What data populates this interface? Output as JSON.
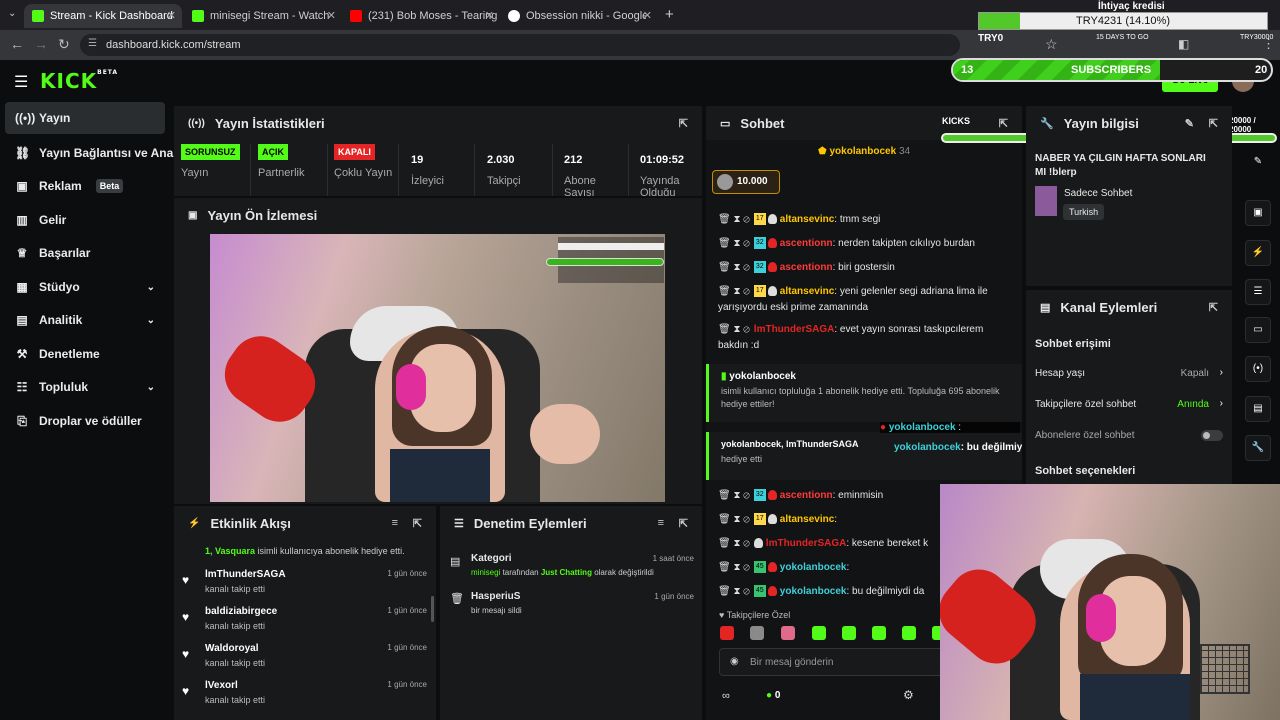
{
  "browser": {
    "tabs": [
      {
        "label": "Stream - Kick Dashboard"
      },
      {
        "label": "minisegi Stream - Watch Live o"
      },
      {
        "label": "(231) Bob Moses - Tearing"
      },
      {
        "label": "Obsession nikki - Google'da Ar"
      }
    ],
    "url": "dashboard.kick.com/stream"
  },
  "overlay": {
    "credit_title": "İhtiyaç kredisi",
    "credit_value": "TRY4231 (14.10%)",
    "try0": "TRY0",
    "days_left": "15 DAYS TO GO",
    "try30000": "TRY30000",
    "sub_count": "13",
    "sub_label": "SUBSCRIBERS",
    "sub_goal": "20",
    "kicks_label": "KICKS",
    "kicks_value": "20000 / 20000"
  },
  "header": {
    "logo": "KICK",
    "logo_beta": "BETA",
    "go_live": "Go Live"
  },
  "sidebar": {
    "items": [
      {
        "label": "Yayın"
      },
      {
        "label": "Yayın Bağlantısı ve Anahtarı"
      },
      {
        "label": "Reklam",
        "badge": "Beta"
      },
      {
        "label": "Gelir"
      },
      {
        "label": "Başarılar"
      },
      {
        "label": "Stüdyo"
      },
      {
        "label": "Analitik"
      },
      {
        "label": "Denetleme"
      },
      {
        "label": "Topluluk"
      },
      {
        "label": "Droplar ve ödüller"
      }
    ]
  },
  "stats": {
    "title": "Yayın İstatistikleri",
    "items": [
      {
        "value": "SORUNSUZ",
        "label": "Yayın"
      },
      {
        "value": "AÇIK",
        "label": "Partnerlik"
      },
      {
        "value": "KAPALI",
        "label": "Çoklu Yayın"
      },
      {
        "value": "19",
        "label": "İzleyici"
      },
      {
        "value": "2.030",
        "label": "Takipçi"
      },
      {
        "value": "212",
        "label": "Abone Sayısı"
      },
      {
        "value": "01:09:52",
        "label": "Yayında Olduğu Süre"
      }
    ]
  },
  "preview": {
    "title": "Yayın Ön İzlemesi"
  },
  "activity": {
    "title": "Etkinlik Akışı",
    "top_note_name": "1, Vasquara",
    "top_note_text": "isimli kullanıcıya abonelik hediye etti.",
    "items": [
      {
        "name": "lmThunderSAGA",
        "sub": "kanalı takip etti",
        "time": "1 gün önce"
      },
      {
        "name": "baldiziabirgece",
        "sub": "kanalı takip etti",
        "time": "1 gün önce"
      },
      {
        "name": "Waldoroyal",
        "sub": "kanalı takip etti",
        "time": "1 gün önce"
      },
      {
        "name": "lVexorl",
        "sub": "kanalı takip etti",
        "time": "1 gün önce"
      }
    ]
  },
  "moderation": {
    "title": "Denetim Eylemleri",
    "items": [
      {
        "name": "Kategori",
        "actor": "minisegi",
        "mid": "tarafından",
        "cat": "Just Chatting",
        "tail": "olarak değiştirildi",
        "time": "1 saat önce"
      },
      {
        "name": "HasperiuS",
        "sub": "bir mesajı sildi",
        "time": "1 gün önce"
      }
    ]
  },
  "chat": {
    "title": "Sohbet",
    "pinned_user": "yokolanbocek",
    "pinned_count": "34",
    "kicks_badge": "10.000",
    "messages": [
      {
        "lvl": "17",
        "user": "altansevinc",
        "text": ": tmm segi"
      },
      {
        "lvl": "32",
        "user": "ascentionn",
        "text": ": nerden takipten cıkılıyo burdan"
      },
      {
        "lvl": "32",
        "user": "ascentionn",
        "text": ": biri gostersin"
      },
      {
        "lvl": "17",
        "user": "altansevinc",
        "text": ": yeni gelenler segi adriana lima ile"
      },
      {
        "lvl": "",
        "user": "",
        "text": "yarışıyordu eski prime zamanında"
      },
      {
        "lvl": "",
        "user": "lmThunderSAGA",
        "text": ": evet yayın sonrası taskıpcılerem"
      },
      {
        "lvl": "",
        "user": "",
        "text": "bakdın :d"
      }
    ],
    "gift1_user": "yokolanbocek",
    "gift1_text": "isimli kullanıcı topluluğa 1 abonelik hediye etti. Topluluğa 695 abonelik hediye ettiler!",
    "gift2_users": "yokolanbocek, lmThunderSAGA",
    "gift2_text": "hediye etti",
    "float1_user": "yokolanbocek",
    "float1_text": " :",
    "float2_user": "yokolanbocek",
    "float2_text": ": bu değilmiydi dansımız :D",
    "messages2": [
      {
        "lvl": "32",
        "user": "ascentionn",
        "text": ": eminmisin"
      },
      {
        "lvl": "17",
        "user": "altansevinc",
        "text": ":"
      },
      {
        "lvl": "",
        "user": "lmThunderSAGA",
        "text": ": kesene bereket k"
      },
      {
        "lvl": "45",
        "user": "yokolanbocek",
        "text": ":"
      },
      {
        "lvl": "45",
        "user": "yokolanbocek",
        "text": ": bu değilmiydi da"
      }
    ],
    "followers_only": "Takipçilere Özel",
    "input_placeholder": "Bir mesaj gönderin",
    "points": "0"
  },
  "stream_info": {
    "title": "Yayın bilgisi",
    "stream_title": "NABER YA ÇILGIN HAFTA SONLARI MI !blerp",
    "category": "Sadece Sohbet",
    "language": "Turkish"
  },
  "channel_actions": {
    "title": "Kanal Eylemleri",
    "section": "Sohbet erişimi",
    "rows": [
      {
        "label": "Hesap yaşı",
        "value": "Kapalı"
      },
      {
        "label": "Takipçilere özel sohbet",
        "value": "Anında"
      },
      {
        "label": "Abonelere özel sohbet",
        "value": ""
      }
    ],
    "section2": "Sohbet seçenekleri"
  },
  "colors": {
    "accent": "#53fc18",
    "panel": "#17191b",
    "red": "#e52525",
    "orange": "#ffc700"
  }
}
